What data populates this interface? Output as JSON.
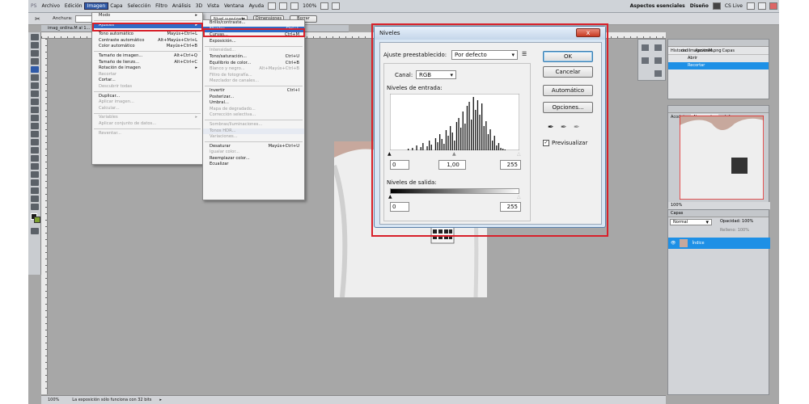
{
  "menubar": {
    "items": [
      "Archivo",
      "Edición",
      "Imagen",
      "Capa",
      "Selección",
      "Filtro",
      "Análisis",
      "3D",
      "Vista",
      "Ventana",
      "Ayuda"
    ],
    "zoom": "100%",
    "workspace": [
      "Aspectos esenciales",
      "Diseño"
    ],
    "cslive": "CS Live"
  },
  "optbar": {
    "width_label": "Anchura:",
    "style": "Nivel suavizado",
    "dims_button": "Dimensiones",
    "clear_button": "Borrar"
  },
  "doc_tab": "imag_ordina.M al 1...",
  "statusbar": {
    "zoom": "100%",
    "message": "La exposición sólo funciona con 32 bits"
  },
  "imagen_menu": [
    {
      "label": "Modo",
      "sub": true
    },
    {
      "sep": true
    },
    {
      "label": "Ajustes",
      "sub": true,
      "hl": true
    },
    {
      "sep": true
    },
    {
      "label": "Tono automático",
      "sc": "Mayús+Ctrl+L"
    },
    {
      "label": "Contraste automático",
      "sc": "Alt+Mayús+Ctrl+L"
    },
    {
      "label": "Color automático",
      "sc": "Mayús+Ctrl+B"
    },
    {
      "sep": true
    },
    {
      "label": "Tamaño de imagen...",
      "sc": "Alt+Ctrl+Q"
    },
    {
      "label": "Tamaño de lienzo...",
      "sc": "Alt+Ctrl+C"
    },
    {
      "label": "Rotación de imagen",
      "sub": true
    },
    {
      "label": "Recortar",
      "dis": true
    },
    {
      "label": "Cortar..."
    },
    {
      "label": "Descubrir todas",
      "dis": true
    },
    {
      "sep": true
    },
    {
      "label": "Duplicar..."
    },
    {
      "label": "Aplicar imagen...",
      "dis": true
    },
    {
      "label": "Calcular...",
      "dis": true
    },
    {
      "sep": true
    },
    {
      "label": "Variables",
      "sub": true,
      "dis": true
    },
    {
      "label": "Aplicar conjunto de datos...",
      "dis": true
    },
    {
      "sep": true
    },
    {
      "label": "Reventar...",
      "dis": true
    }
  ],
  "ajustes_menu": [
    {
      "label": "Brillo/contraste..."
    },
    {
      "label": "Niveles...",
      "sc": "Ctrl+L",
      "hl": true
    },
    {
      "label": "Curvas...",
      "sc": "Ctrl+M"
    },
    {
      "label": "Exposición..."
    },
    {
      "sep": true
    },
    {
      "label": "Intensidad...",
      "dis": true
    },
    {
      "label": "Tono/saturación...",
      "sc": "Ctrl+U"
    },
    {
      "label": "Equilibrio de color...",
      "sc": "Ctrl+B"
    },
    {
      "label": "Blanco y negro...",
      "sc": "Alt+Mayús+Ctrl+B",
      "dis": true
    },
    {
      "label": "Filtro de fotografía...",
      "dis": true
    },
    {
      "label": "Mezclador de canales...",
      "dis": true
    },
    {
      "sep": true
    },
    {
      "label": "Invertir",
      "sc": "Ctrl+I"
    },
    {
      "label": "Posterizar..."
    },
    {
      "label": "Umbral..."
    },
    {
      "label": "Mapa de degradado...",
      "dis": true
    },
    {
      "label": "Corrección selectiva...",
      "dis": true
    },
    {
      "sep": true
    },
    {
      "label": "Sombras/iluminaciones...",
      "dis": true
    },
    {
      "label": "Tonos HDR...",
      "dis": true,
      "soft": true
    },
    {
      "label": "Variaciones...",
      "dis": true
    },
    {
      "sep": true
    },
    {
      "label": "Desaturar",
      "sc": "Mayús+Ctrl+U"
    },
    {
      "label": "Igualar color...",
      "dis": true
    },
    {
      "label": "Reemplazar color..."
    },
    {
      "label": "Ecualizar"
    }
  ],
  "dialog": {
    "title": "Niveles",
    "preset_label": "Ajuste preestablecido:",
    "preset_value": "Por defecto",
    "channel_label": "Canal:",
    "channel_value": "RGB",
    "input_label": "Niveles de entrada:",
    "input_values": [
      "0",
      "1,00",
      "255"
    ],
    "output_label": "Niveles de salida:",
    "output_values": [
      "0",
      "255"
    ],
    "ok": "OK",
    "cancel": "Cancelar",
    "auto": "Automático",
    "options": "Opciones...",
    "preview": "Previsualizar",
    "close": "x"
  },
  "history_panel": {
    "tabs": [
      "Historia",
      "Acciones",
      "Capas"
    ],
    "file": "ordiImageviniM.png",
    "items": [
      "Abrir",
      "Recortar"
    ]
  },
  "navigator_panel": {
    "tabs": [
      "Acodat",
      "Navegador",
      "Informa"
    ],
    "zoom": "100%"
  },
  "layers_panel": {
    "title": "Capas",
    "blend": "Normal",
    "opacity_label": "Opacidad:",
    "opacity": "100%",
    "fill_label": "Relleno:",
    "fill": "100%",
    "layer_name": "Índice"
  },
  "colors": {
    "accent": "#2f6ac5",
    "highlight": "#d8202a",
    "layer_selected": "#1e90e6"
  }
}
